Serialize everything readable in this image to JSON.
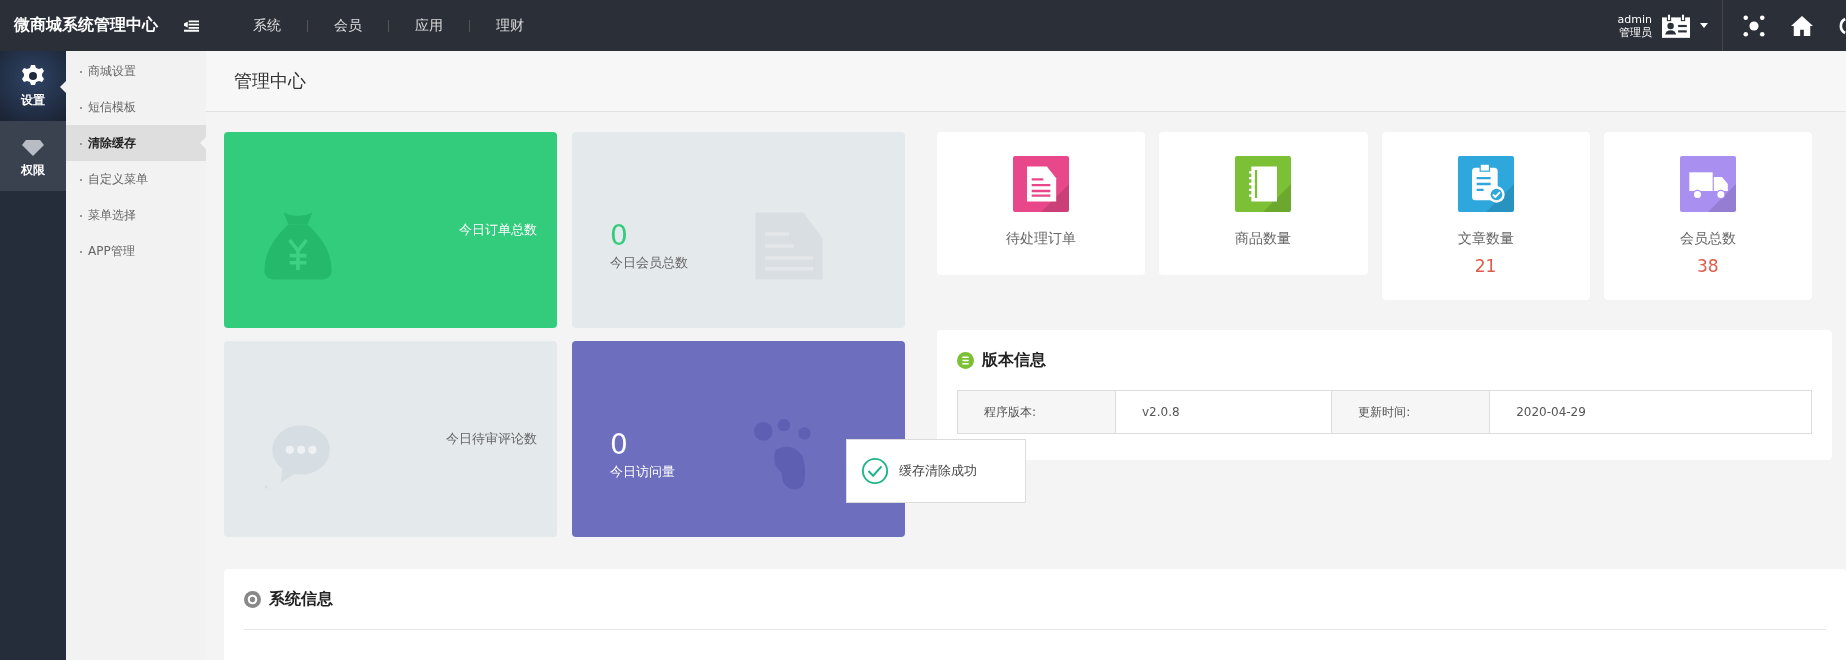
{
  "app": {
    "title": "微商城系统管理中心"
  },
  "top_nav": [
    {
      "label": "系统"
    },
    {
      "label": "会员"
    },
    {
      "label": "应用"
    },
    {
      "label": "理财"
    }
  ],
  "user": {
    "name": "admin",
    "role": "管理员"
  },
  "side_modules": [
    {
      "kind": "settings",
      "label": "设置",
      "selected": true
    },
    {
      "kind": "permissions",
      "label": "权限",
      "selected": false
    }
  ],
  "submenu": [
    {
      "label": "商城设置",
      "selected": false
    },
    {
      "label": "短信模板",
      "selected": false
    },
    {
      "label": "清除缓存",
      "selected": true
    },
    {
      "label": "自定义菜单",
      "selected": false
    },
    {
      "label": "菜单选择",
      "selected": false
    },
    {
      "label": "APP管理",
      "selected": false
    }
  ],
  "page_title": "管理中心",
  "stat_tiles": [
    {
      "kind": "orders",
      "label": "今日订单总数"
    },
    {
      "kind": "members",
      "value": "0",
      "label": "今日会员总数"
    },
    {
      "kind": "comments",
      "label": "今日待审评论数"
    },
    {
      "kind": "visits",
      "value": "0",
      "label": "今日访问量"
    }
  ],
  "quick_stats": [
    {
      "kind": "orders",
      "label": "待处理订单"
    },
    {
      "kind": "goods",
      "label": "商品数量"
    },
    {
      "kind": "articles",
      "label": "文章数量",
      "value": "21"
    },
    {
      "kind": "members",
      "label": "会员总数",
      "value": "38"
    }
  ],
  "version_panel": {
    "title": "版本信息",
    "cells": [
      "程序版本:",
      "v2.0.8",
      "更新时间:",
      "2020-04-29"
    ]
  },
  "toast": {
    "message": "缓存清除成功"
  },
  "system_panel": {
    "title": "系统信息"
  }
}
